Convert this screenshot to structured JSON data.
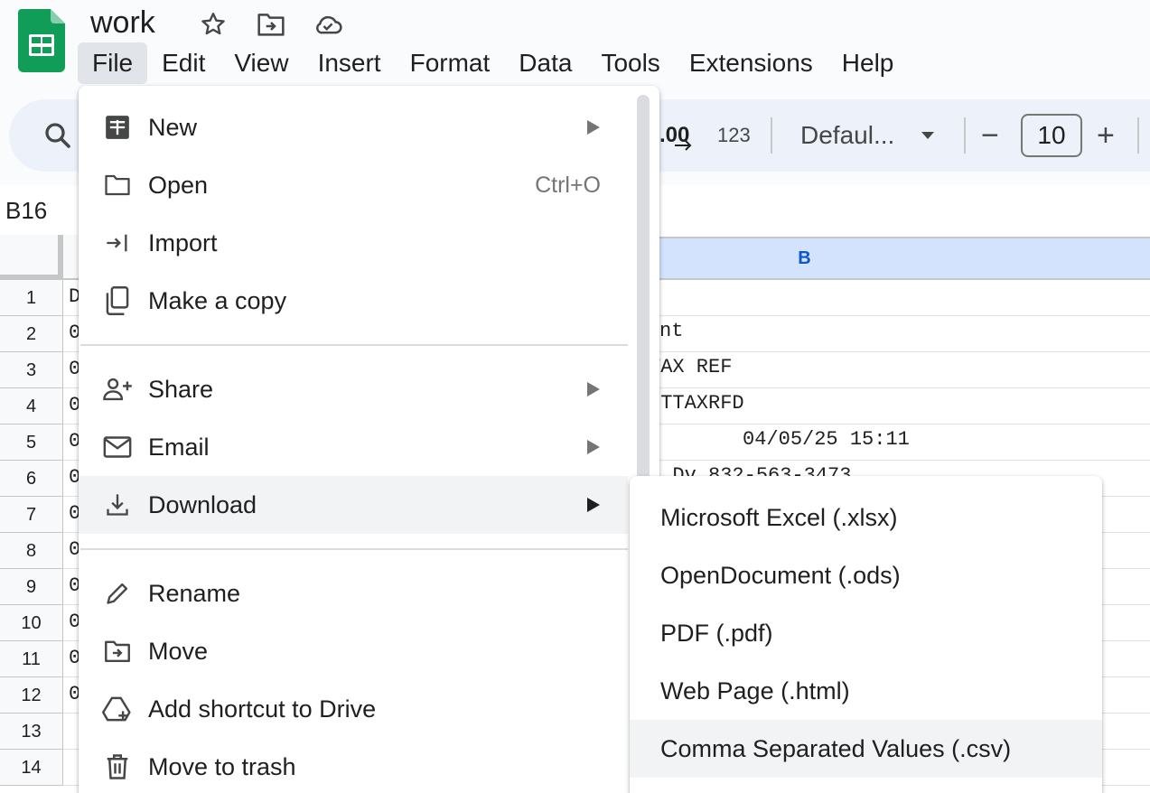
{
  "doc": {
    "title": "work"
  },
  "menu_bar": [
    "File",
    "Edit",
    "View",
    "Insert",
    "Format",
    "Data",
    "Tools",
    "Extensions",
    "Help"
  ],
  "toolbar": {
    "decimal_label": ".00",
    "number_format_label": "123",
    "font_name": "Defaul...",
    "font_size": "10",
    "decrease_label": "−",
    "increase_label": "+"
  },
  "name_box": "B16",
  "grid": {
    "column_b_header": "B",
    "row_numbers": [
      "1",
      "2",
      "3",
      "4",
      "5",
      "6",
      "7",
      "8",
      "9",
      "10",
      "11",
      "12",
      "13",
      "14"
    ],
    "col_a_cells": [
      "D",
      "0",
      "0",
      "0",
      "0",
      "0",
      "0",
      "0",
      "0",
      "0",
      "0",
      "0"
    ],
    "col_b_cells": {
      "r2": "nt",
      "r3": "TAX REF",
      "r4": "OTTAXRFD",
      "r5": "          04/05/25 15:11",
      "r6": "  Dv 832-563-3473"
    }
  },
  "file_menu": {
    "items": [
      {
        "label": "New",
        "icon": "new-spreadsheet-icon",
        "submenu": true
      },
      {
        "label": "Open",
        "icon": "folder-icon",
        "shortcut": "Ctrl+O"
      },
      {
        "label": "Import",
        "icon": "import-icon"
      },
      {
        "label": "Make a copy",
        "icon": "copy-icon"
      },
      {
        "label": "Share",
        "icon": "share-person-icon",
        "submenu": true
      },
      {
        "label": "Email",
        "icon": "email-icon",
        "submenu": true
      },
      {
        "label": "Download",
        "icon": "download-icon",
        "submenu": true
      },
      {
        "label": "Rename",
        "icon": "pencil-icon"
      },
      {
        "label": "Move",
        "icon": "move-folder-icon"
      },
      {
        "label": "Add shortcut to Drive",
        "icon": "drive-shortcut-icon"
      },
      {
        "label": "Move to trash",
        "icon": "trash-icon"
      }
    ]
  },
  "download_submenu": {
    "items": [
      "Microsoft Excel (.xlsx)",
      "OpenDocument (.ods)",
      "PDF (.pdf)",
      "Web Page (.html)",
      "Comma Separated Values (.csv)"
    ]
  },
  "colors": {
    "sheets_green": "#0f9d58",
    "selected_column": "#d3e3fd",
    "toolbar_bg": "#edf2fa",
    "menu_hover": "#f1f3f4"
  }
}
